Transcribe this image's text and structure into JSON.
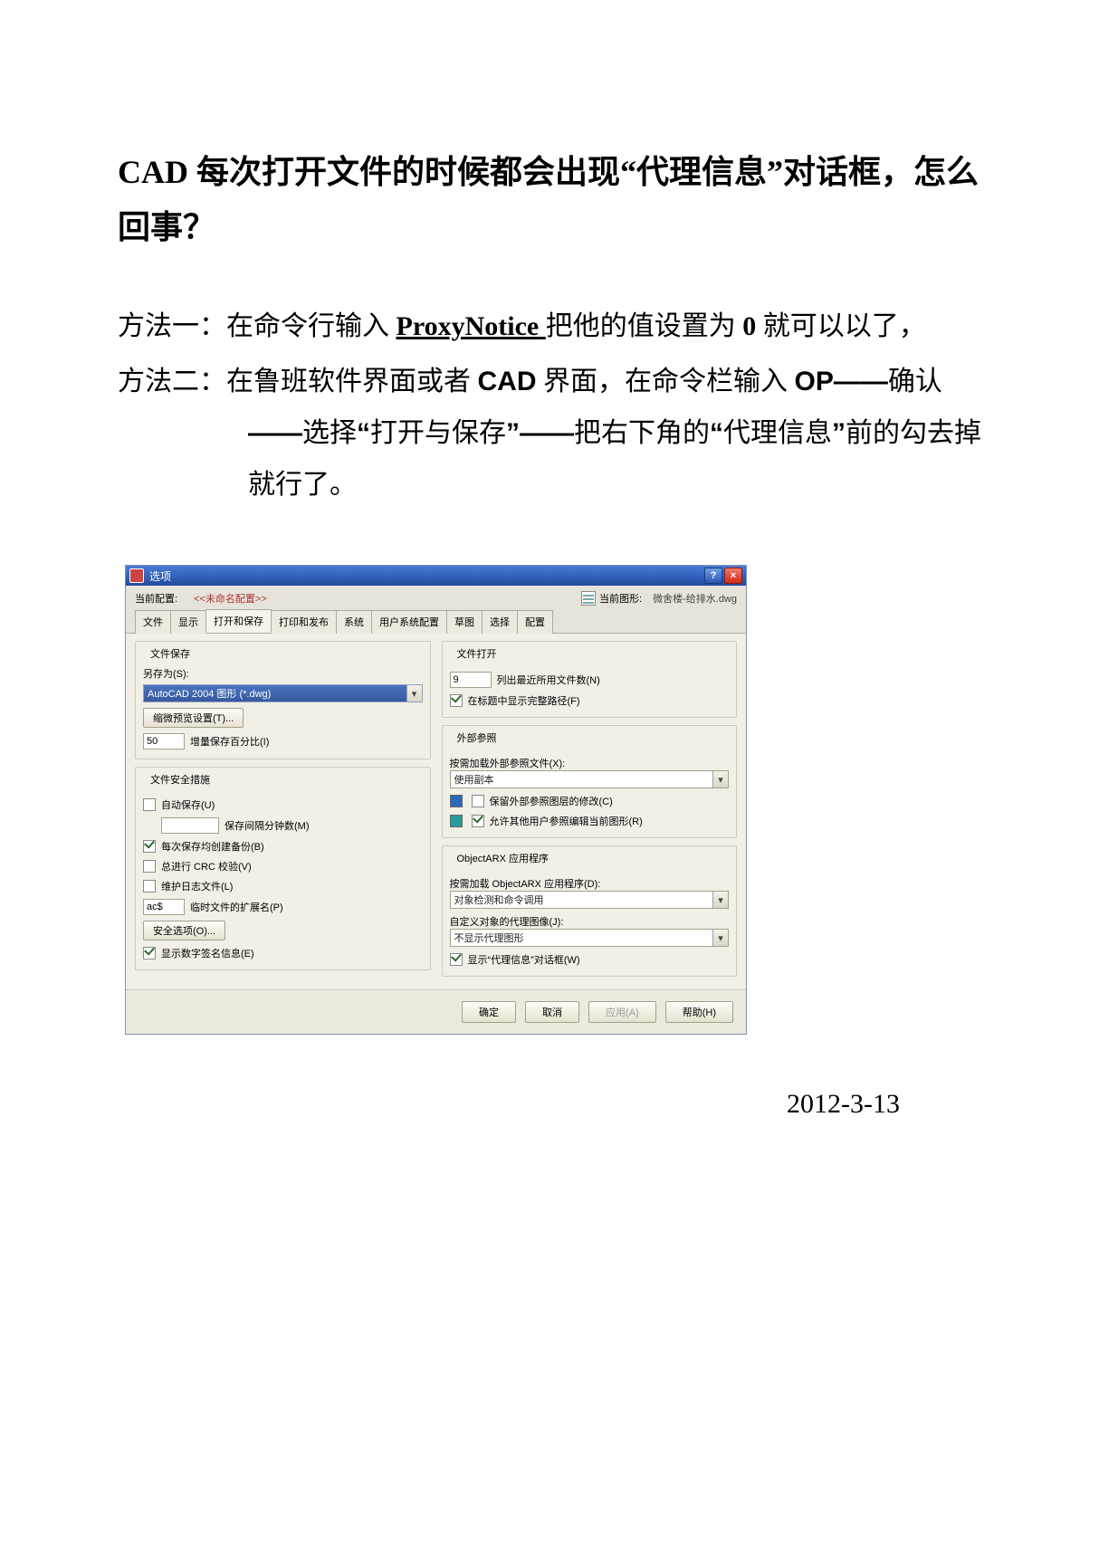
{
  "doc": {
    "title": "CAD 每次打开文件的时候都会出现“代理信息”对话框，怎么回事？",
    "method1_prefix": "方法一：在命令行输入 ",
    "method1_cmd": "ProxyNotice ",
    "method1_mid": "把他的值设置为 ",
    "method1_val": "0",
    "method1_suffix": " 就可以以了，",
    "method2_prefix": "方法二：在鲁班软件界面或者 ",
    "method2_cad": "CAD",
    "method2_a": " 界面，在命令栏输入 ",
    "method2_op": "OP——",
    "method2_b": "确认",
    "method2_d1": "——",
    "method2_c": "选择",
    "method2_q1": "“",
    "method2_open": "打开与保存",
    "method2_q2": "”——",
    "method2_d": "把右下角的",
    "method2_q3": "“",
    "method2_proxy": "代理信息",
    "method2_q4": "”",
    "method2_e": "前的勾去掉就行了。",
    "date": "2012-3-13"
  },
  "dlg": {
    "title": "选项",
    "help": "?",
    "close": "×",
    "cfg_label": "当前配置:",
    "cfg_value": "<<未命名配置>>",
    "file_icon_label": "当前图形:",
    "file_value": "微舍楼-给排水.dwg",
    "tabs": [
      "文件",
      "显示",
      "打开和保存",
      "打印和发布",
      "系统",
      "用户系统配置",
      "草图",
      "选择",
      "配置"
    ],
    "left": {
      "g1_title": "文件保存",
      "saveas_label": "另存为(S):",
      "saveas_value": "AutoCAD 2004 图形 (*.dwg)",
      "thumb_btn": "缩微预览设置(T)...",
      "inc_value": "50",
      "inc_label": "增量保存百分比(I)",
      "g2_title": "文件安全措施",
      "autobackup": "自动保存(U)",
      "interval_label": "保存间隔分钟数(M)",
      "bak": "每次保存均创建备份(B)",
      "crc": "总进行 CRC 校验(V)",
      "log": "维护日志文件(L)",
      "ext_value": "ac$",
      "ext_label": "临时文件的扩展名(P)",
      "secopt": "安全选项(O)...",
      "digsig": "显示数字签名信息(E)"
    },
    "right": {
      "g1_title": "文件打开",
      "recent_value": "9",
      "recent_label": "列出最近所用文件数(N)",
      "fullpath": "在标题中显示完整路径(F)",
      "g2_title": "外部参照",
      "xref_label": "按需加载外部参照文件(X):",
      "xref_value": "使用副本",
      "xref_opt1": "保留外部参照图层的修改(C)",
      "xref_opt2": "允许其他用户参照编辑当前图形(R)",
      "g3_title": "ObjectARX 应用程序",
      "arx_label": "按需加载 ObjectARX 应用程序(D):",
      "arx_value": "对象检测和命令调用",
      "proxy_label": "自定义对象的代理图像(J):",
      "proxy_value": "不显示代理图形",
      "proxy_dialog": "显示“代理信息”对话框(W)"
    },
    "footer": {
      "ok": "确定",
      "cancel": "取消",
      "apply": "应用(A)",
      "help": "帮助(H)"
    }
  }
}
